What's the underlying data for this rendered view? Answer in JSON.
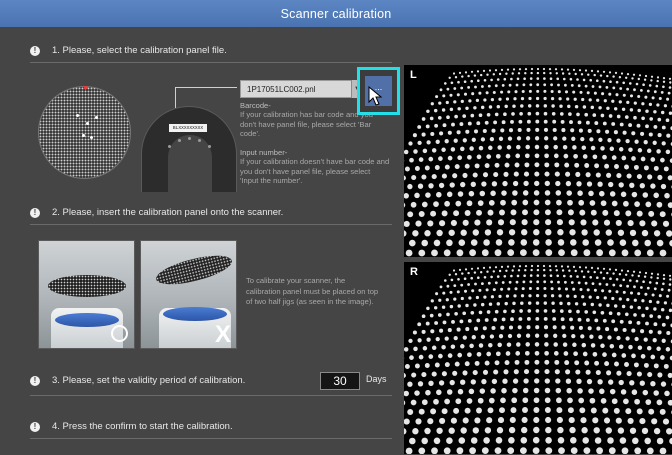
{
  "window": {
    "title": "Scanner calibration"
  },
  "step1": {
    "text": "1. Please, select the calibration panel file.",
    "file_value": "1P17051LC002.pnl",
    "browse_label": "...",
    "barcode_text": "BLXXXXXXXXX",
    "barcode_head": "Barcode-",
    "barcode_desc": "If your calibration has bar code and you don't have panel file, please select 'Bar code'.",
    "input_head": "Input number-",
    "input_desc": "If your calibration doesn't have bar code and you don't have panel file, please select 'Input the number'."
  },
  "step2": {
    "text": "2. Please, insert the calibration panel onto the scanner.",
    "ok_mark": "O",
    "no_mark": "X",
    "note": "To calibrate your scanner, the calibration panel must be placed on top of two half jigs (as seen in the image)."
  },
  "step3": {
    "text": "3. Please, set the validity period of calibration.",
    "days_value": "30",
    "days_unit": "Days"
  },
  "step4": {
    "text": "4. Press the confirm to start the calibration."
  },
  "cameras": {
    "left_label": "L",
    "right_label": "R"
  },
  "icons": {
    "step_marker": "exclamation-icon",
    "cursor": "mouse-pointer-icon",
    "dropdown": "chevron-down-icon"
  },
  "colors": {
    "titlebar": "#4f79b8",
    "highlight": "#22e0ea",
    "browse": "#5270a8",
    "background": "#454545"
  }
}
